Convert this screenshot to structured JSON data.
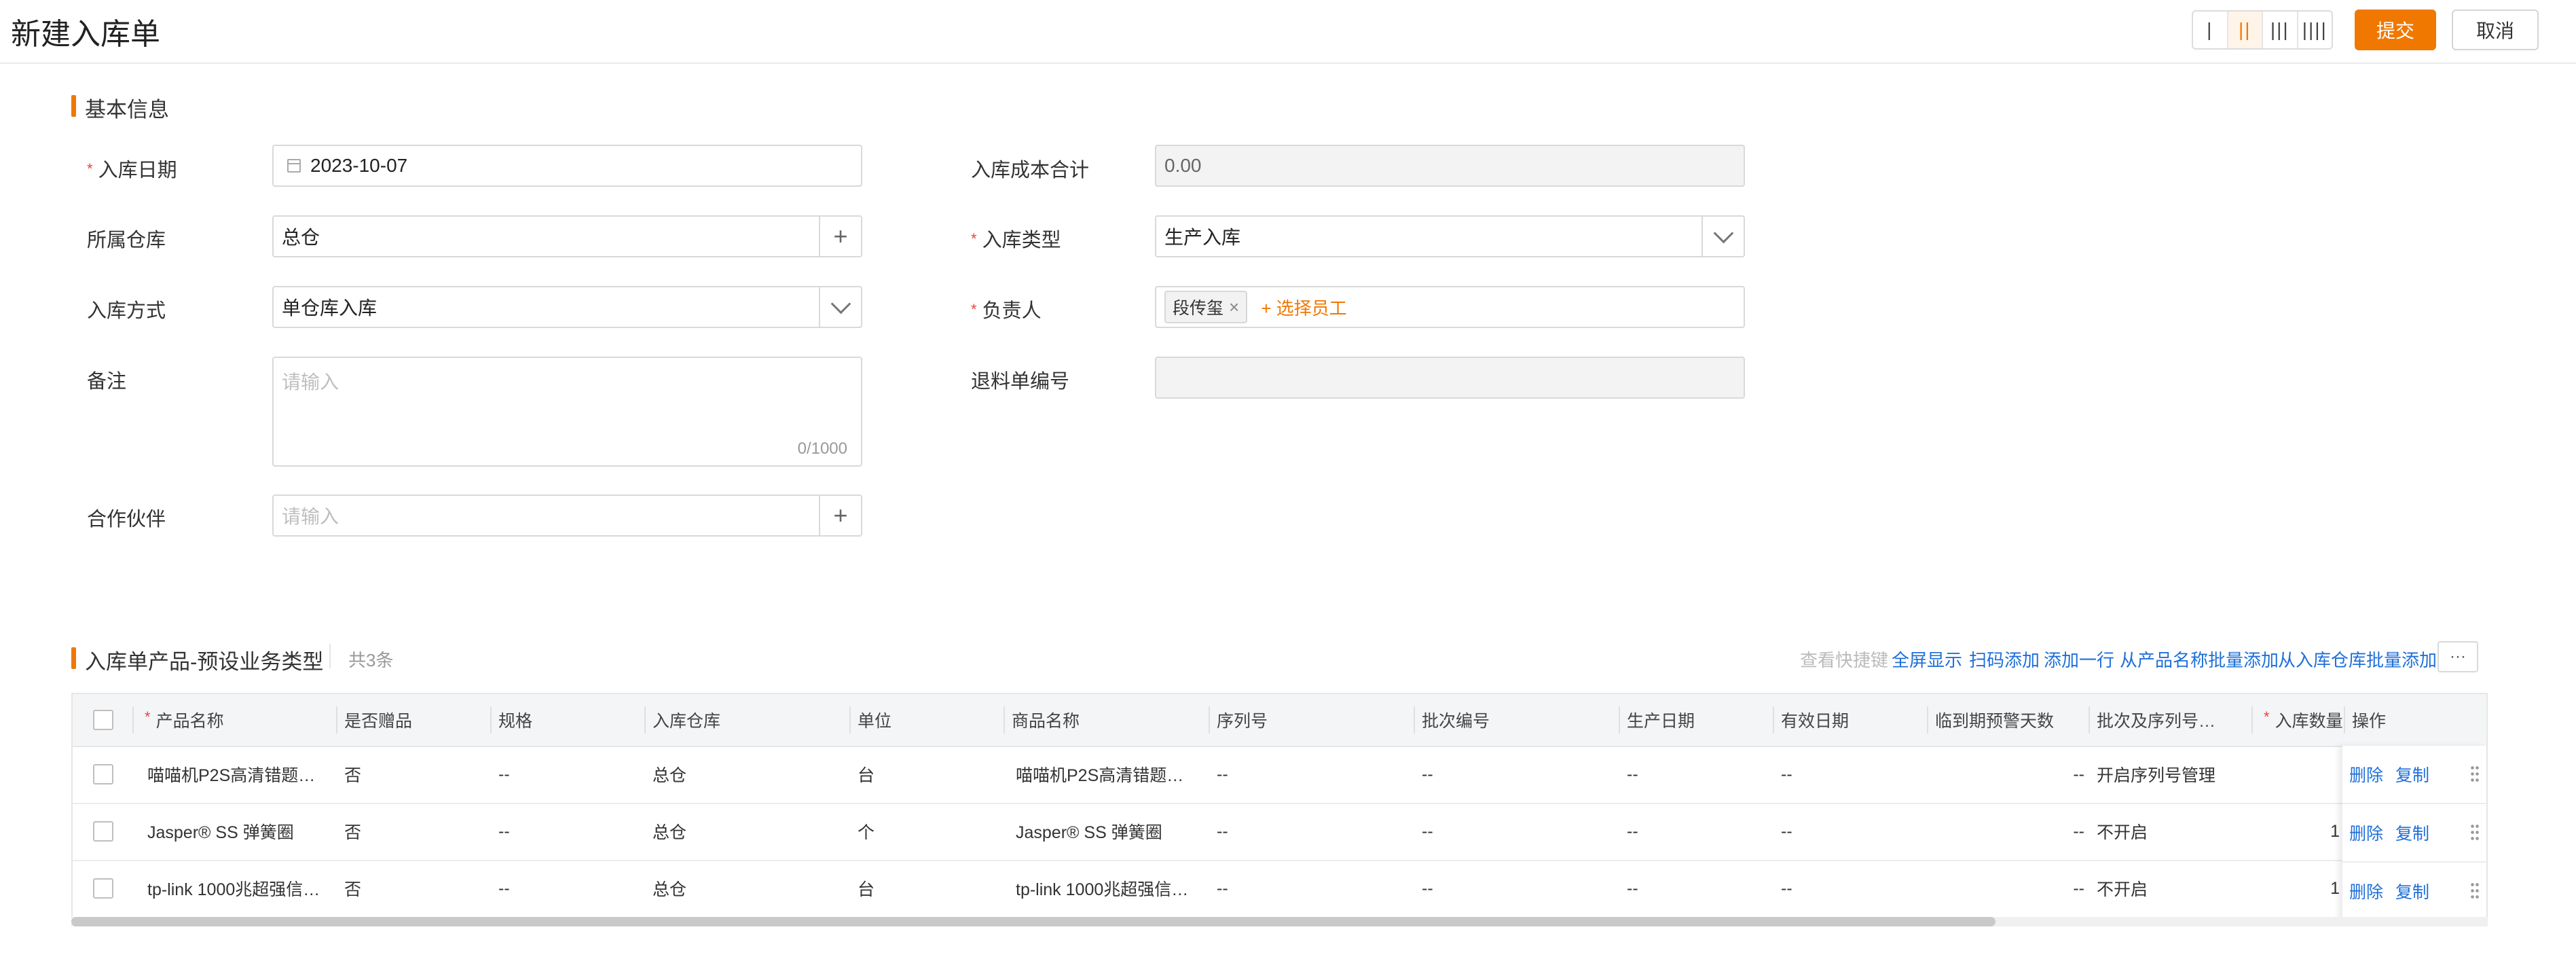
{
  "header": {
    "title": "新建入库单",
    "column_switch": [
      "Ⅰ",
      "Ⅱ",
      "Ⅲ",
      "Ⅳ"
    ],
    "column_switch_glyphs": [
      "|",
      "||",
      "|||",
      "||||"
    ],
    "column_switch_active_index": 1,
    "submit_label": "提交",
    "cancel_label": "取消"
  },
  "basic_info": {
    "section_title": "基本信息",
    "date": {
      "label": "入库日期",
      "value": "2023-10-07",
      "required": true
    },
    "warehouse": {
      "label": "所属仓库",
      "value": "总仓",
      "addon": "+"
    },
    "method": {
      "label": "入库方式",
      "value": "单仓库入库"
    },
    "remark": {
      "label": "备注",
      "placeholder": "请输入",
      "counter": "0/1000"
    },
    "partner": {
      "label": "合作伙伴",
      "placeholder": "请输入",
      "addon": "+"
    },
    "cost_total": {
      "label": "入库成本合计",
      "value": "0.00"
    },
    "type": {
      "label": "入库类型",
      "value": "生产入库",
      "required": true
    },
    "owner": {
      "label": "负责人",
      "tag": "段传玺",
      "tag_close": "×",
      "pick_label": "+ 选择员工",
      "required": true
    },
    "return_no": {
      "label": "退料单编号",
      "value": ""
    }
  },
  "products": {
    "section_title": "入库单产品-预设业务类型",
    "count_label": "共3条",
    "toolbar": {
      "shortcuts": "查看快捷键",
      "fullscreen": "全屏显示",
      "scan_add": "扫码添加",
      "add_row": "添加一行",
      "batch_by_name": "从产品名称批量添加",
      "batch_by_warehouse": "从入库仓库批量添加",
      "more": "···"
    },
    "columns": [
      "产品名称",
      "是否赠品",
      "规格",
      "入库仓库",
      "单位",
      "商品名称",
      "序列号",
      "批次编号",
      "生产日期",
      "有效日期",
      "临到期预警天数",
      "批次及序列号…",
      "入库数量",
      "操作"
    ],
    "rows": [
      {
        "name": "喵喵机P2S高清错题…",
        "gift": "否",
        "spec": "--",
        "warehouse": "总仓",
        "unit": "台",
        "goods": "喵喵机P2S高清错题…",
        "serial": "--",
        "batch": "--",
        "prod_date": "--",
        "exp_date": "--",
        "warn_days": "--",
        "batch_serial": "开启序列号管理",
        "qty": "",
        "delete": "删除",
        "copy": "复制"
      },
      {
        "name": "Jasper® SS 弹簧圈",
        "gift": "否",
        "spec": "--",
        "warehouse": "总仓",
        "unit": "个",
        "goods": "Jasper® SS 弹簧圈",
        "serial": "--",
        "batch": "--",
        "prod_date": "--",
        "exp_date": "--",
        "warn_days": "--",
        "batch_serial": "不开启",
        "qty": "1",
        "delete": "删除",
        "copy": "复制"
      },
      {
        "name": "tp-link 1000兆超强信…",
        "gift": "否",
        "spec": "--",
        "warehouse": "总仓",
        "unit": "台",
        "goods": "tp-link 1000兆超强信…",
        "serial": "--",
        "batch": "--",
        "prod_date": "--",
        "exp_date": "--",
        "warn_days": "--",
        "batch_serial": "不开启",
        "qty": "1",
        "delete": "删除",
        "copy": "复制"
      }
    ]
  },
  "colors": {
    "accent": "#f07800",
    "link": "#1e6fd9",
    "required": "#e8453c"
  }
}
